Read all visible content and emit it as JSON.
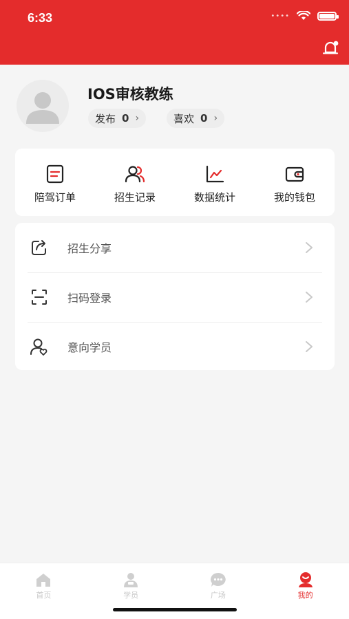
{
  "status_bar": {
    "time": "6:33",
    "battery_level": 1.0
  },
  "profile": {
    "name": "IOS审核教练",
    "publish": {
      "label": "发布",
      "count": "0"
    },
    "likes": {
      "label": "喜欢",
      "count": "0"
    }
  },
  "shortcuts": [
    {
      "label": "陪驾订单",
      "icon": "order-icon"
    },
    {
      "label": "招生记录",
      "icon": "users-icon"
    },
    {
      "label": "数据统计",
      "icon": "chart-icon"
    },
    {
      "label": "我的钱包",
      "icon": "wallet-icon"
    }
  ],
  "menu": [
    {
      "label": "招生分享",
      "icon": "share-icon"
    },
    {
      "label": "扫码登录",
      "icon": "scan-icon"
    },
    {
      "label": "意向学员",
      "icon": "student-icon"
    }
  ],
  "tabs": [
    {
      "label": "首页",
      "icon": "home-icon",
      "active": false
    },
    {
      "label": "学员",
      "icon": "student-tab-icon",
      "active": false
    },
    {
      "label": "广场",
      "icon": "chat-icon",
      "active": false
    },
    {
      "label": "我的",
      "icon": "profile-tab-icon",
      "active": true
    }
  ],
  "colors": {
    "brand": "#e42c2c",
    "background": "#f5f5f5",
    "tab_inactive": "#c9c9c9"
  }
}
